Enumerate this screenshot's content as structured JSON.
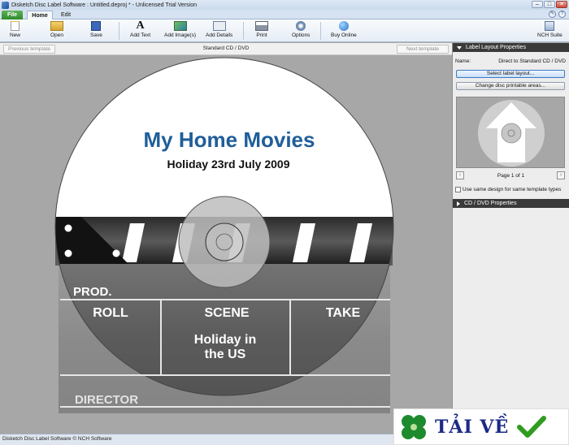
{
  "window": {
    "title": "Disketch Disc Label Software : Untitled.deproj * - Unlicensed Trial Version",
    "controls": [
      "–",
      "□",
      "✕"
    ]
  },
  "ribbon": {
    "tabs": [
      {
        "label": "File",
        "icon": "file-tab"
      },
      {
        "label": "Home",
        "icon": "home-tab"
      },
      {
        "label": "Edit",
        "icon": "edit-tab"
      }
    ],
    "help_icons": [
      "options-small-icon",
      "help-icon"
    ]
  },
  "toolbar": {
    "new": "New",
    "open": "Open",
    "save": "Save",
    "add_text": "Add Text",
    "add_images": "Add Image(s)",
    "add_details": "Add Details",
    "print": "Print",
    "options": "Options",
    "buy_online": "Buy Online",
    "nch_suite": "NCH Suite"
  },
  "template_nav": {
    "previous": "Previous template",
    "title": "Standard CD / DVD",
    "next": "Next template"
  },
  "disc_label": {
    "title": "My Home Movies",
    "subtitle": "Holiday 23rd July 2009",
    "prod": "PROD.",
    "roll": "ROLL",
    "scene": "SCENE",
    "take": "TAKE",
    "scene_value_line1": "Holiday in",
    "scene_value_line2": "the US",
    "director": "DIRECTOR",
    "colors": {
      "title": "#1f5e99",
      "subtitle": "#111111",
      "slate_text": "#ffffff"
    }
  },
  "right_panel": {
    "header": "Label Layout Properties",
    "name_label": "Name:",
    "name_value": "Direct to Standard CD / DVD",
    "select_layout": "Select label layout...",
    "change_areas": "Change disc printable areas...",
    "page_info": "Page 1 of 1",
    "prev_page": "‹",
    "next_page": "›",
    "same_design": "Use same design for same template types",
    "cd_dvd_header": "CD / DVD Properties"
  },
  "statusbar": {
    "text": "Disketch Disc Label Software © NCH Software"
  },
  "watermark": {
    "text": "TẢI VỀ"
  }
}
